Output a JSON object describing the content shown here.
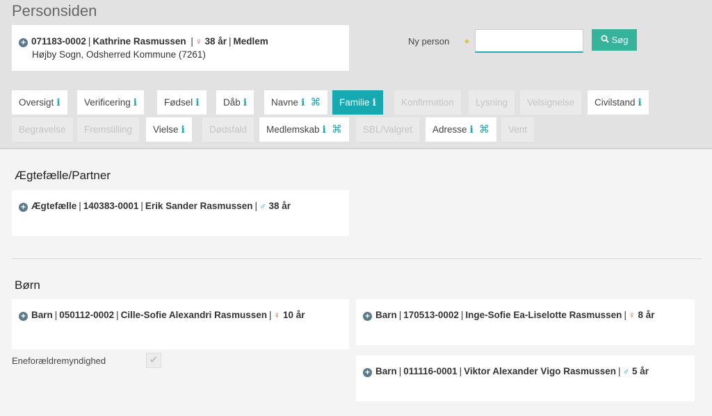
{
  "page": {
    "title": "Personsiden"
  },
  "person": {
    "cpr": "071183-0002",
    "name": "Kathrine Rasmussen",
    "age": "38 år",
    "status": "Medlem",
    "location": "Højby Sogn, Odsherred Kommune (7261)"
  },
  "search": {
    "label": "Ny person",
    "value": "",
    "button_label": "Søg"
  },
  "tabs": [
    {
      "label": "Oversigt",
      "info": true,
      "cmd": false,
      "state": "normal"
    },
    {
      "label": "Verificering",
      "info": true,
      "cmd": false,
      "state": "normal"
    },
    {
      "label": "Fødsel",
      "info": true,
      "cmd": false,
      "state": "normal"
    },
    {
      "label": "Dåb",
      "info": true,
      "cmd": false,
      "state": "normal"
    },
    {
      "label": "Navne",
      "info": true,
      "cmd": true,
      "state": "normal"
    },
    {
      "label": "Familie",
      "info": true,
      "cmd": false,
      "state": "active"
    },
    {
      "label": "Konfirmation",
      "info": false,
      "cmd": false,
      "state": "disabled"
    },
    {
      "label": "Lysning",
      "info": false,
      "cmd": false,
      "state": "disabled"
    },
    {
      "label": "Velsignelse",
      "info": false,
      "cmd": false,
      "state": "disabled"
    },
    {
      "label": "Civilstand",
      "info": true,
      "cmd": false,
      "state": "normal"
    },
    {
      "label": "Begravelse",
      "info": false,
      "cmd": false,
      "state": "disabled"
    },
    {
      "label": "Fremstilling",
      "info": false,
      "cmd": false,
      "state": "disabled"
    },
    {
      "label": "Vielse",
      "info": true,
      "cmd": false,
      "state": "normal"
    },
    {
      "label": "Dødsfald",
      "info": false,
      "cmd": false,
      "state": "disabled"
    },
    {
      "label": "Medlemskab",
      "info": true,
      "cmd": true,
      "state": "normal"
    },
    {
      "label": "SBL/Valgret",
      "info": false,
      "cmd": false,
      "state": "disabled"
    },
    {
      "label": "Adresse",
      "info": true,
      "cmd": true,
      "state": "normal"
    },
    {
      "label": "Vent",
      "info": false,
      "cmd": false,
      "state": "disabled"
    }
  ],
  "spouse_section": {
    "title": "Ægtefælle/Partner",
    "entry": {
      "role": "Ægtefælle",
      "cpr": "140383-0001",
      "name": "Erik Sander Rasmussen",
      "gender": "male",
      "age": "38 år"
    }
  },
  "children_section": {
    "title": "Børn",
    "children": [
      {
        "role": "Barn",
        "cpr": "050112-0002",
        "name": "Cille-Sofie Alexandri Rasmussen",
        "gender": "female",
        "age": "10 år"
      },
      {
        "role": "Barn",
        "cpr": "170513-0002",
        "name": "Inge-Sofie Ea-Liselotte Rasmussen",
        "gender": "female",
        "age": "8 år"
      },
      {
        "role": "Barn",
        "cpr": "011116-0001",
        "name": "Viktor Alexander Vigo Rasmussen",
        "gender": "male",
        "age": "5 år"
      }
    ],
    "custody_label": "Eneforældremyndighed",
    "custody_checked": true
  },
  "icons": {
    "plus": "plus-circle-icon",
    "female": "female-figure-icon",
    "male": "male-figure-icon",
    "search": "search-icon",
    "info": "info-icon",
    "command": "command-icon"
  },
  "colors": {
    "accent": "#17a9b2",
    "search_button": "#37b39c",
    "female": "#d9531e",
    "male": "#2a8fb0"
  }
}
